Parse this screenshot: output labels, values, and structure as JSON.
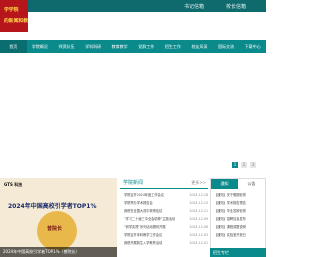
{
  "topbar": {
    "links": [
      "书记信箱",
      "校长信箱"
    ]
  },
  "logo": {
    "line1": "学学院",
    "line2": "的新闻和教学"
  },
  "nav": {
    "items": [
      "首页",
      "学院概况",
      "师资队伍",
      "学科科研",
      "教育教学",
      "党群工作",
      "招生工作",
      "校友风采",
      "国际交流",
      "下载中心"
    ]
  },
  "pager": [
    "1",
    "2",
    "3"
  ],
  "news_image": {
    "brand": "GTS 科技",
    "title": "2024年中国高校引学者TOP1%",
    "seal": "曾院长",
    "caption": "2024年中国高校引学者TOP1%（曾院长）"
  },
  "news": {
    "heading": "学院新闻",
    "more": "更多>>",
    "items": [
      {
        "t": "学院召开2024年度工作会议",
        "d": "2024-12-18"
      },
      {
        "t": "学院举办学术报告会",
        "d": "2024-12-15"
      },
      {
        "t": "我院在全国大赛中获得佳绩",
        "d": "2024-12-11"
      },
      {
        "t": "“学习二十届三中全会精神”主题活动",
        "d": "2024-12-09"
      },
      {
        "t": "“研学实践”系列活动顺利开展",
        "d": "2024-12-06"
      },
      {
        "t": "学院召开本科教学工作会议",
        "d": "2024-12-03"
      },
      {
        "t": "我院开展新生入学教育活动",
        "d": "2024-12-01"
      }
    ]
  },
  "notice": {
    "tabs": [
      "通知",
      "公告"
    ],
    "items": [
      "【通知】关于假期安排",
      "【通知】学术报告预告",
      "【通知】毕业答辩安排",
      "【通知】招聘信息发布",
      "【通知】课程调整说明",
      "【通知】实验室开放日"
    ],
    "footer": "招生专栏"
  }
}
